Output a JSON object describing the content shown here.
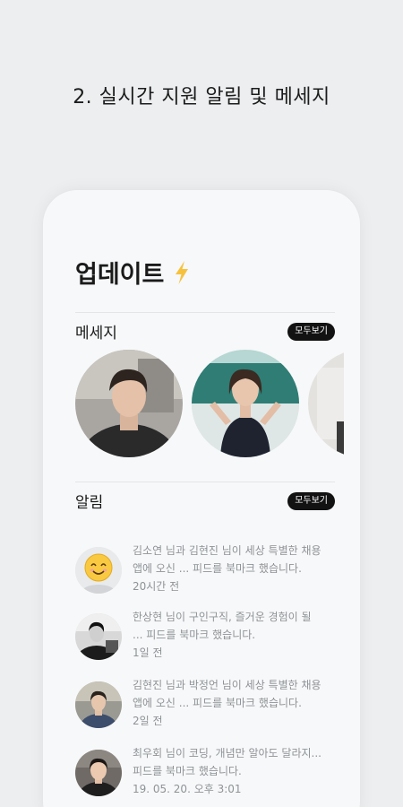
{
  "caption": "2. 실시간 지원 알림 및 메세지",
  "screen": {
    "title": "업데이트",
    "title_icon": "lightning-bolt-icon",
    "accent_color": "#f6c23e"
  },
  "messages": {
    "label": "메세지",
    "see_all": "모두보기",
    "avatars": [
      "person-photo",
      "person-photo",
      "person-photo"
    ]
  },
  "notifications": {
    "label": "알림",
    "see_all": "모두보기",
    "items": [
      {
        "line1": "김소연 님과 김현진 님이 세상 특별한 채용",
        "line2": "앱에 오신 ... 피드를 북마크 했습니다.",
        "time": "20시간 전",
        "avatar": "smiley-face-icon"
      },
      {
        "line1": "한상현 님이 구인구직, 즐거운 경험이 될",
        "line2": "... 피드를 북마크 했습니다.",
        "time": "1일 전",
        "avatar": "person-photo"
      },
      {
        "line1": "김현진 님과 박정언 님이 세상 특별한 채용",
        "line2": "앱에 오신 ... 피드를 북마크 했습니다.",
        "time": "2일 전",
        "avatar": "person-photo"
      },
      {
        "line1": "최우회 님이 코딩, 개념만 알아도 달라지...",
        "line2": "피드를 북마크 했습니다.",
        "time": "19. 05. 20. 오후 3:01",
        "avatar": "person-photo"
      }
    ]
  }
}
